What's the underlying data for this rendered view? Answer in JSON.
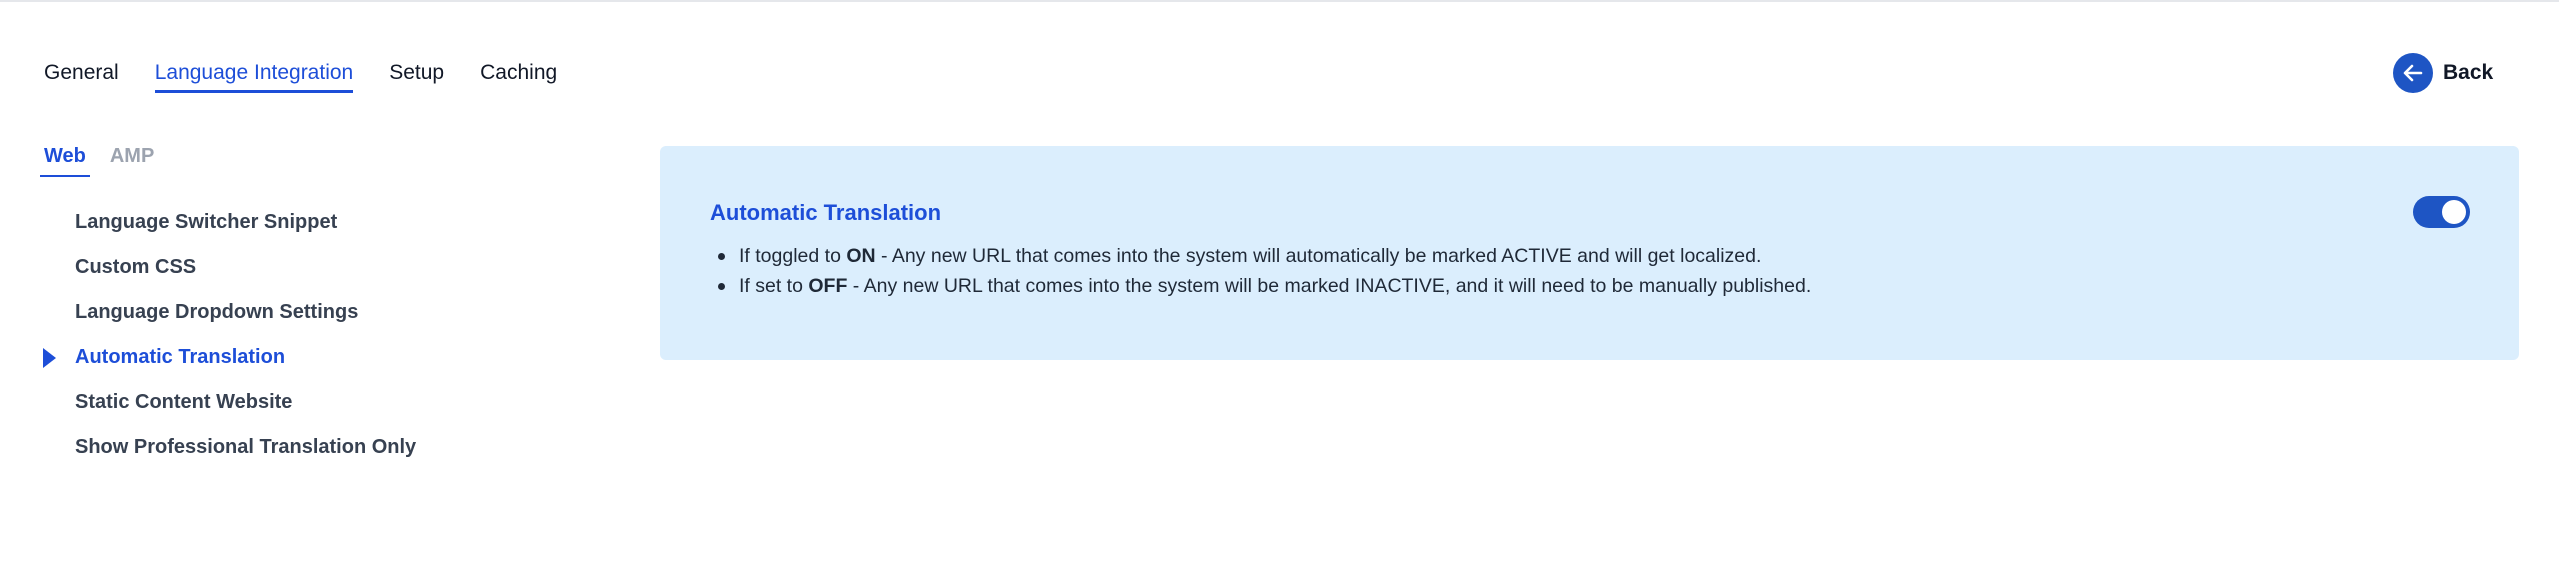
{
  "tabs": [
    {
      "label": "General",
      "active": false
    },
    {
      "label": "Language Integration",
      "active": true
    },
    {
      "label": "Setup",
      "active": false
    },
    {
      "label": "Caching",
      "active": false
    }
  ],
  "back": {
    "label": "Back",
    "icon": "arrow-left-icon"
  },
  "subtabs": [
    {
      "label": "Web",
      "active": true
    },
    {
      "label": "AMP",
      "active": false
    }
  ],
  "menu": [
    {
      "label": "Language Switcher Snippet",
      "active": false
    },
    {
      "label": "Custom CSS",
      "active": false
    },
    {
      "label": "Language Dropdown Settings",
      "active": false
    },
    {
      "label": "Automatic Translation",
      "active": true
    },
    {
      "label": "Static Content Website",
      "active": false
    },
    {
      "label": "Show Professional Translation Only",
      "active": false
    }
  ],
  "panel": {
    "title": "Automatic Translation",
    "toggle_on": true,
    "bullets": [
      {
        "prefix": "If toggled to ",
        "emphasis": "ON",
        "suffix": " - Any new URL that comes into the system will automatically be marked ACTIVE and will get localized."
      },
      {
        "prefix": "If set to ",
        "emphasis": "OFF",
        "suffix": " - Any new URL that comes into the system will be marked INACTIVE, and it will need to be manually published."
      }
    ]
  },
  "colors": {
    "accent": "#1d4ed8",
    "button_blue": "#1e55c4",
    "panel_bg": "#dbeefd"
  }
}
